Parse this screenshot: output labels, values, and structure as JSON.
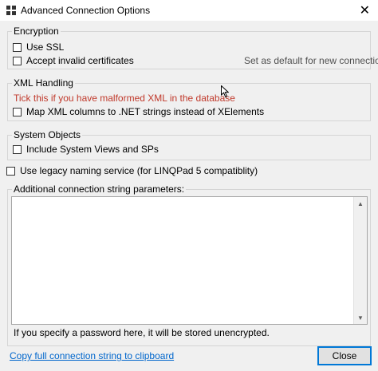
{
  "window": {
    "title": "Advanced Connection Options",
    "close_glyph": "✕"
  },
  "encryption": {
    "legend": "Encryption",
    "use_ssl": "Use SSL",
    "accept_invalid": "Accept invalid certificates",
    "set_default": "Set as default for new connections"
  },
  "xml": {
    "legend": "XML Handling",
    "warning": "Tick this if you have malformed XML in the database",
    "map_columns": "Map XML columns to .NET strings instead of XElements"
  },
  "system_objects": {
    "legend": "System Objects",
    "include_views": "Include System Views and SPs"
  },
  "legacy_naming": "Use legacy naming service (for LINQPad 5 compatiblity)",
  "additional": {
    "legend": "Additional connection string parameters:",
    "value": "",
    "note": "If you specify a password here, it will be stored unencrypted."
  },
  "footer": {
    "copy_link": "Copy full connection string to clipboard",
    "close_button": "Close"
  },
  "colors": {
    "accent": "#0078d7",
    "warning": "#c0392b",
    "link": "#0066cc"
  }
}
